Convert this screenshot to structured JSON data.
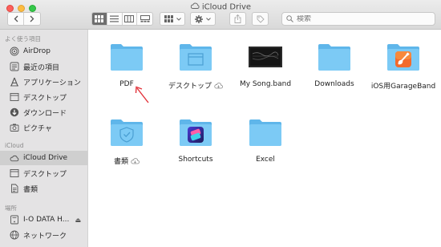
{
  "window": {
    "title": "iCloud Drive"
  },
  "toolbar": {
    "search_placeholder": "検索",
    "colors": {
      "active_view": "#6e6e6e"
    }
  },
  "sidebar": {
    "sections": {
      "favorites": "よく使う項目",
      "icloud": "iCloud",
      "locations": "場所"
    },
    "favorites": [
      {
        "label": "AirDrop",
        "icon": "airdrop-icon"
      },
      {
        "label": "最近の項目",
        "icon": "recents-icon"
      },
      {
        "label": "アプリケーション",
        "icon": "applications-icon"
      },
      {
        "label": "デスクトップ",
        "icon": "desktop-icon"
      },
      {
        "label": "ダウンロード",
        "icon": "downloads-icon"
      },
      {
        "label": "ピクチャ",
        "icon": "pictures-icon"
      }
    ],
    "icloud": [
      {
        "label": "iCloud Drive",
        "icon": "cloud-icon",
        "selected": true
      },
      {
        "label": "デスクトップ",
        "icon": "desktop-icon"
      },
      {
        "label": "書類",
        "icon": "documents-icon"
      }
    ],
    "locations": [
      {
        "label": "I-O DATA H...",
        "icon": "drive-icon"
      },
      {
        "label": "ネットワーク",
        "icon": "network-icon"
      }
    ]
  },
  "files": [
    {
      "name": "PDF",
      "type": "folder"
    },
    {
      "name": "デスクトップ",
      "type": "folder",
      "cloud": true
    },
    {
      "name": "My Song.band",
      "type": "garageband-file"
    },
    {
      "name": "Downloads",
      "type": "folder"
    },
    {
      "name": "iOS用GarageBand",
      "type": "app-folder"
    },
    {
      "name": "書類",
      "type": "folder",
      "cloud": true
    },
    {
      "name": "Shortcuts",
      "type": "app-folder"
    },
    {
      "name": "Excel",
      "type": "folder"
    }
  ],
  "colors": {
    "folder": "#6cc3f5",
    "arrow": "#e3343c"
  }
}
